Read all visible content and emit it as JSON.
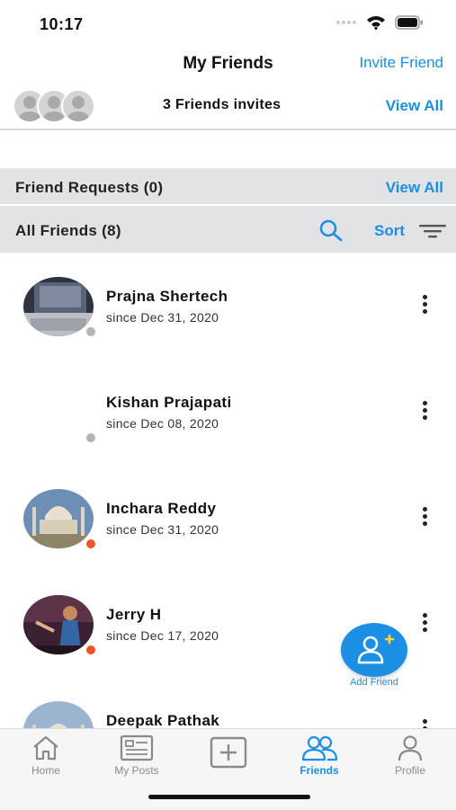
{
  "status_bar": {
    "time": "10:17"
  },
  "nav": {
    "title": "My Friends",
    "invite_label": "Invite Friend"
  },
  "invites": {
    "count_text": "3 Friends invites",
    "view_all_label": "View All"
  },
  "friend_requests": {
    "label": "Friend Requests (0)",
    "view_all_label": "View All"
  },
  "all_friends": {
    "label": "All Friends (8)",
    "sort_label": "Sort"
  },
  "friends": [
    {
      "name": "Prajna Shertech",
      "since": "since Dec 31, 2020",
      "status_color": "#b4b4b4"
    },
    {
      "name": "Kishan Prajapati",
      "since": "since Dec 08, 2020",
      "status_color": "#b4b4b4"
    },
    {
      "name": "Inchara Reddy",
      "since": "since Dec 31, 2020",
      "status_color": "#f0522a"
    },
    {
      "name": "Jerry H",
      "since": "since Dec 17, 2020",
      "status_color": "#f0522a"
    },
    {
      "name": "Deepak Pathak",
      "since": "",
      "status_color": ""
    }
  ],
  "fab": {
    "label": "Add Friend"
  },
  "tabbar": {
    "items": [
      {
        "label": "Home",
        "icon": "home-icon"
      },
      {
        "label": "My Posts",
        "icon": "posts-icon"
      },
      {
        "label": "",
        "icon": "add-post-icon"
      },
      {
        "label": "Friends",
        "icon": "friends-icon"
      },
      {
        "label": "Profile",
        "icon": "profile-icon"
      }
    ]
  },
  "colors": {
    "accent": "#1a8fe3",
    "section_bg": "#e2e3e6",
    "offline": "#b4b4b4",
    "online": "#f0522a"
  }
}
